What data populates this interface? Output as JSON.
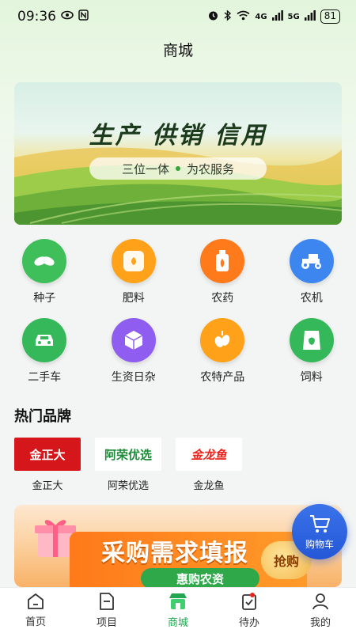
{
  "status_bar": {
    "time": "09:36",
    "battery": "81",
    "network_1": "4G",
    "network_2": "5G"
  },
  "header": {
    "title": "商城"
  },
  "banner": {
    "headline": "生产 供销 信用",
    "tagline_left": "三位一体",
    "tagline_right": "为农服务"
  },
  "categories": [
    {
      "label": "种子",
      "icon": "seed-icon",
      "color": "#3fbf5a"
    },
    {
      "label": "肥料",
      "icon": "fertilizer-bag-icon",
      "color": "#ffa21a"
    },
    {
      "label": "农药",
      "icon": "pesticide-bottle-icon",
      "color": "#ff7a1a"
    },
    {
      "label": "农机",
      "icon": "tractor-icon",
      "color": "#3d86f0"
    },
    {
      "label": "二手车",
      "icon": "used-car-icon",
      "color": "#34b85a"
    },
    {
      "label": "生资日杂",
      "icon": "box-icon",
      "color": "#8f5ef0"
    },
    {
      "label": "农特产品",
      "icon": "olive-icon",
      "color": "#ffa21a"
    },
    {
      "label": "饲料",
      "icon": "feed-bag-icon",
      "color": "#34b85a"
    }
  ],
  "hot_brands": {
    "title": "热门品牌",
    "items": [
      {
        "name": "金正大",
        "logo_text": "金正大",
        "color": "#d5161b"
      },
      {
        "name": "阿荣优选",
        "logo_text": "阿荣优选",
        "color": "#1e8a3a"
      },
      {
        "name": "金龙鱼",
        "logo_text": "金龙鱼",
        "color": "#e8241c"
      }
    ]
  },
  "promo": {
    "title": "采购需求填报",
    "subtitle": "惠购农资",
    "badge": "抢购"
  },
  "cart": {
    "label": "购物车"
  },
  "tabs": [
    {
      "label": "首页",
      "icon": "home-icon"
    },
    {
      "label": "项目",
      "icon": "document-icon"
    },
    {
      "label": "商城",
      "icon": "store-icon",
      "active": true
    },
    {
      "label": "待办",
      "icon": "todo-clipboard-icon"
    },
    {
      "label": "我的",
      "icon": "profile-icon"
    }
  ],
  "colors": {
    "accent_green": "#22a652",
    "fab_blue": "#2d63e0",
    "promo_orange": "#ff7a1a"
  }
}
